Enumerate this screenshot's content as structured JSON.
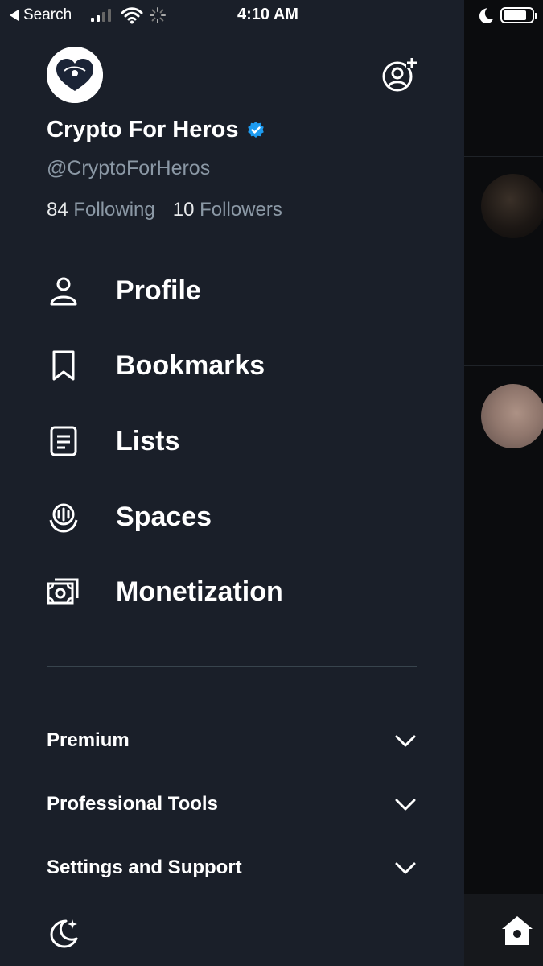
{
  "status_bar": {
    "back_label": "Search",
    "time": "4:10 AM"
  },
  "profile": {
    "display_name": "Crypto For Heros",
    "handle": "@CryptoForHeros",
    "following_count": "84",
    "following_label": "Following",
    "followers_count": "10",
    "followers_label": "Followers",
    "verified": true
  },
  "menu": {
    "items": [
      {
        "label": "Profile",
        "icon": "person-icon"
      },
      {
        "label": "Bookmarks",
        "icon": "bookmark-icon"
      },
      {
        "label": "Lists",
        "icon": "list-icon"
      },
      {
        "label": "Spaces",
        "icon": "spaces-icon"
      },
      {
        "label": "Monetization",
        "icon": "money-icon"
      }
    ]
  },
  "sections": {
    "items": [
      {
        "label": "Premium"
      },
      {
        "label": "Professional Tools"
      },
      {
        "label": "Settings and Support"
      }
    ]
  },
  "colors": {
    "drawer_bg": "#1a1f29",
    "verified_blue": "#1d9bf0",
    "muted_text": "#8b98a5"
  }
}
